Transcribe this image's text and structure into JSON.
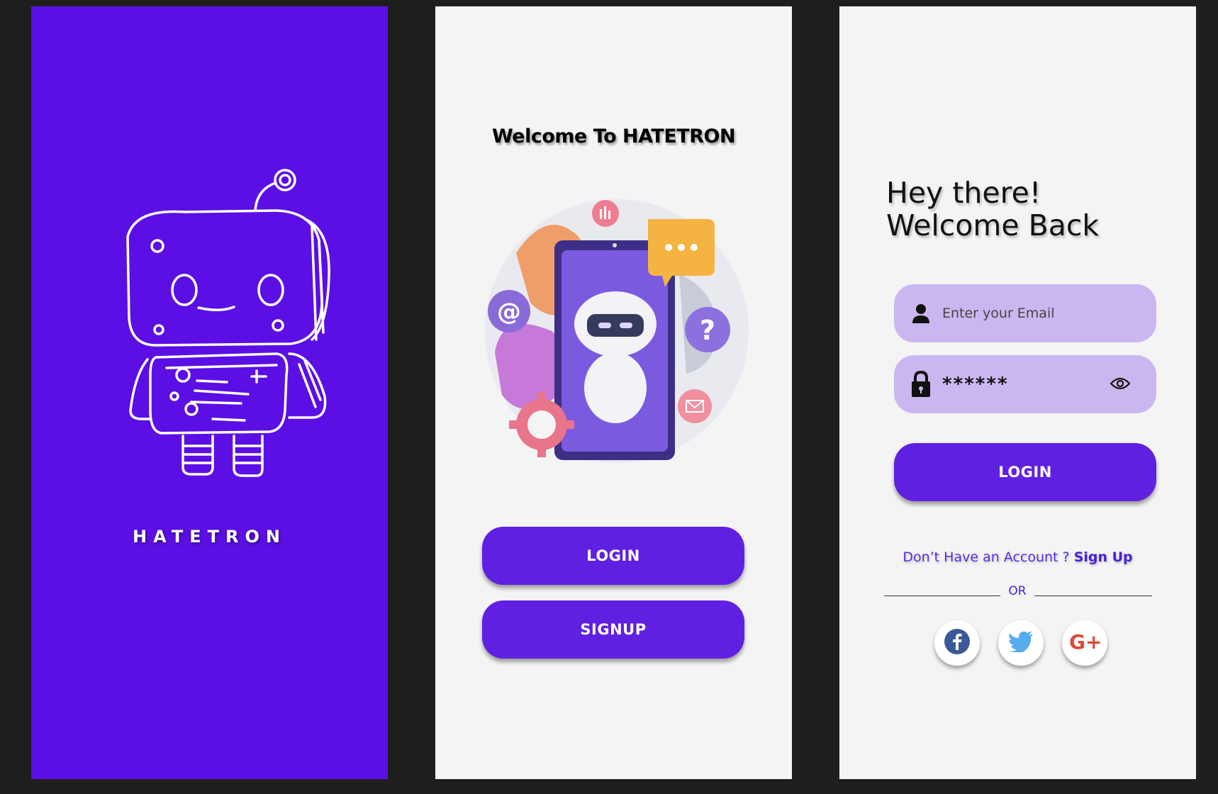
{
  "splash": {
    "brand": "HATETRON"
  },
  "welcome": {
    "title": "Welcome To HATETRON",
    "login_label": "LOGIN",
    "signup_label": "SIGNUP"
  },
  "login": {
    "greeting_line1": "Hey there!",
    "greeting_line2": "Welcome Back",
    "email_placeholder": "Enter your Email",
    "password_value": "******",
    "login_label": "LOGIN",
    "no_account_text": "Don’t Have an Account ?",
    "signup_link": "Sign Up",
    "or_text": "OR"
  },
  "icons": {
    "email_field": "user-icon",
    "password_field": "lock-icon",
    "show_password": "eye-icon",
    "social": [
      "facebook-icon",
      "twitter-icon",
      "google-plus-icon"
    ]
  },
  "colors": {
    "brand_purple": "#5b0fe4",
    "button_purple": "#6020e2",
    "field_lavender": "#cbb7f0",
    "screen_background": "#f4f4f4",
    "canvas": "#1e1e1e"
  }
}
